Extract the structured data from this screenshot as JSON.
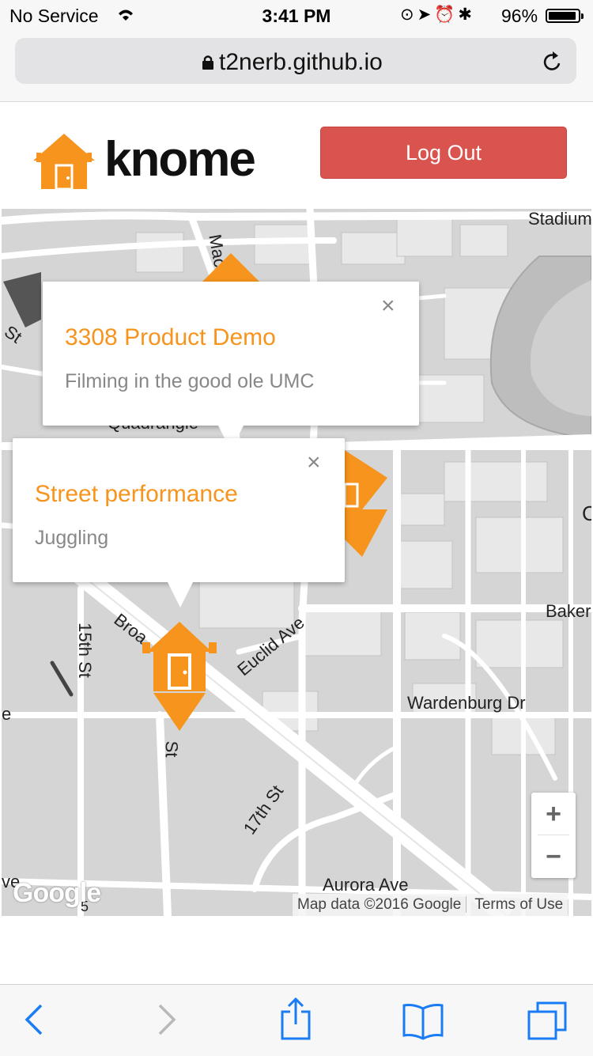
{
  "status_bar": {
    "carrier": "No Service",
    "time": "3:41 PM",
    "battery_percent": "96%",
    "battery_level": 0.96,
    "icons": [
      "wifi-icon",
      "rotation-lock-icon",
      "location-arrow-icon",
      "alarm-icon",
      "bluetooth-icon",
      "battery-icon"
    ]
  },
  "browser": {
    "url": "t2nerb.github.io",
    "secure": true,
    "toolbar_icons": [
      "back-icon",
      "forward-icon",
      "share-icon",
      "bookmarks-icon",
      "tabs-icon"
    ]
  },
  "app": {
    "name": "knome",
    "logout_label": "Log Out",
    "brand_color": "#f7941d",
    "button_color": "#d9534f"
  },
  "map": {
    "street_labels": {
      "stadium": "Stadium",
      "st_left": "St",
      "mac": "Mac",
      "quadrangle": "Quadrangle",
      "c_right": "C",
      "baker": "Baker",
      "broadway": "Broa",
      "fifteenth": "15th St",
      "euclid": "Euclid Ave",
      "wardenburg": "Wardenburg Dr",
      "st_bottom": "St",
      "e_left": "e",
      "seventeenth": "17th St",
      "ve_left": "ve",
      "aurora": "Aurora Ave",
      "five": "5"
    },
    "zoom_in": "+",
    "zoom_out": "−",
    "google_logo": "Google",
    "attribution": "Map data ©2016 Google",
    "terms": "Terms of Use"
  },
  "info_windows": [
    {
      "title": "3308 Product Demo",
      "description": "Filming in the good ole UMC",
      "close": "×"
    },
    {
      "title": "Street performance",
      "description": "Juggling",
      "close": "×"
    }
  ]
}
